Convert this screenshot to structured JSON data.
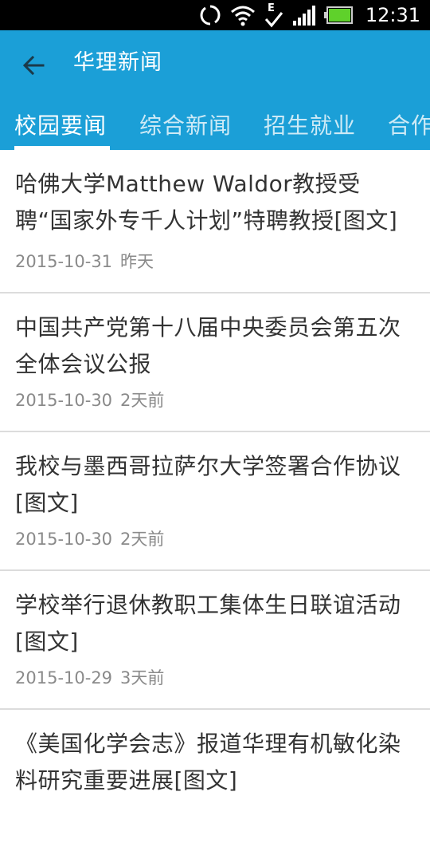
{
  "status_bar": {
    "time": "12:31"
  },
  "app_bar": {
    "title": "华理新闻"
  },
  "tabs": [
    {
      "label": "校园要闻",
      "active": true
    },
    {
      "label": "综合新闻",
      "active": false
    },
    {
      "label": "招生就业",
      "active": false
    },
    {
      "label": "合作",
      "active": false
    }
  ],
  "news": [
    {
      "title": "哈佛大学Matthew Waldor教授受聘“国家外专千人计划”特聘教授[图文]",
      "date": "2015-10-31",
      "ago": "昨天"
    },
    {
      "title": "中国共产党第十八届中央委员会第五次全体会议公报",
      "date": "2015-10-30",
      "ago": "2天前"
    },
    {
      "title": "我校与墨西哥拉萨尔大学签署合作协议[图文]",
      "date": "2015-10-30",
      "ago": "2天前"
    },
    {
      "title": "学校举行退休教职工集体生日联谊活动[图文]",
      "date": "2015-10-29",
      "ago": "3天前"
    },
    {
      "title": "《美国化学会志》报道华理有机敏化染料研究重要进展[图文]",
      "date": "",
      "ago": ""
    }
  ],
  "colors": {
    "primary": "#1b9fd7",
    "status_bar": "#000000",
    "title_text": "#333333",
    "meta_text": "#8a8a8a"
  },
  "icons": {
    "back": "arrow-left-icon",
    "sync": "sync-icon",
    "wifi": "wifi-icon",
    "signal": "signal-icon",
    "battery": "battery-icon",
    "network_e": "edge-network-icon"
  }
}
